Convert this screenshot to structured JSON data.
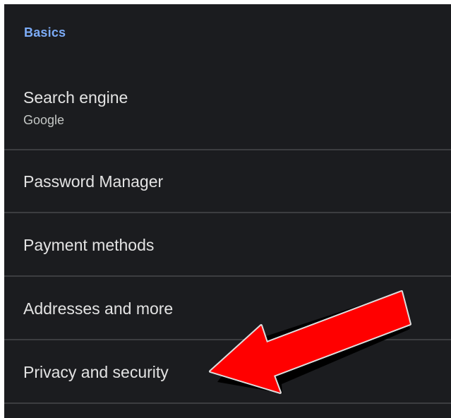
{
  "section": {
    "header": "Basics"
  },
  "settings": {
    "items": [
      {
        "title": "Search engine",
        "subtitle": "Google"
      },
      {
        "title": "Password Manager"
      },
      {
        "title": "Payment methods"
      },
      {
        "title": "Addresses and more"
      },
      {
        "title": "Privacy and security"
      }
    ]
  },
  "annotation": {
    "arrow_color": "#ff0000",
    "points_to": "Privacy and security"
  },
  "colors": {
    "background": "#1b1c1f",
    "section_header": "#7cacf8",
    "text_primary": "#e3e3e3",
    "text_secondary": "#c4c7c5",
    "divider": "#3c3d40"
  }
}
